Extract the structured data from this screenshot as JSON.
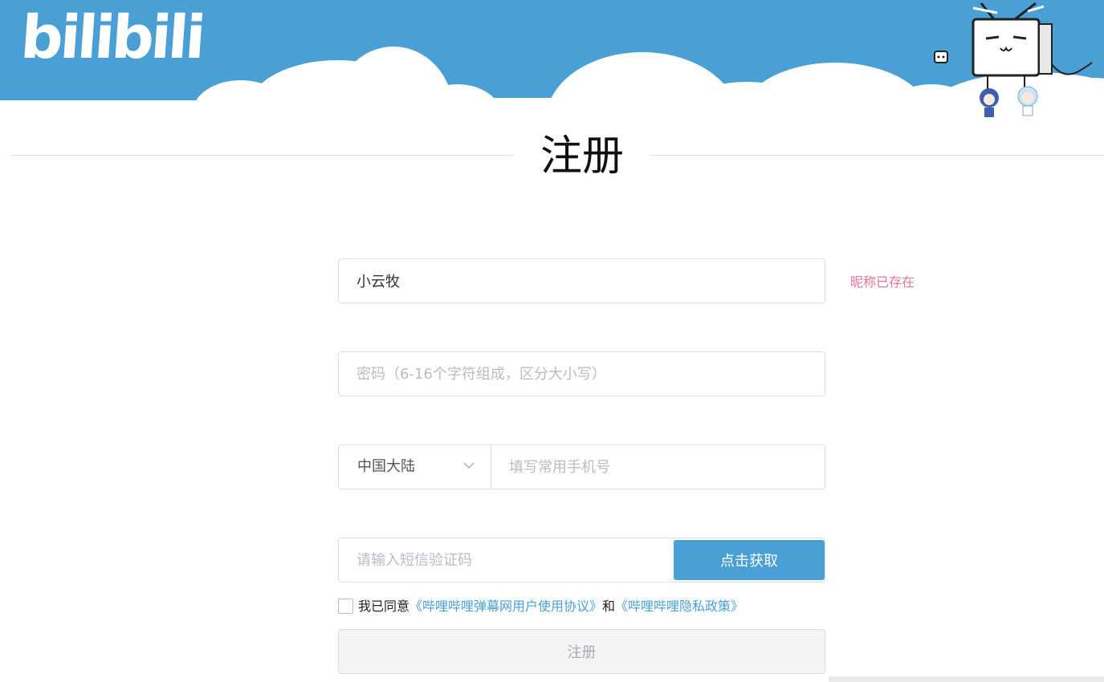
{
  "header": {
    "logo_text": "bilibili",
    "brand_color": "#4a9fd5"
  },
  "page": {
    "title": "注册"
  },
  "form": {
    "nickname": {
      "value": "小云牧",
      "placeholder": "",
      "error": "昵称已存在"
    },
    "password": {
      "value": "",
      "placeholder": "密码（6-16个字符组成，区分大小写）"
    },
    "phone": {
      "region_value": "中国大陆",
      "value": "",
      "placeholder": "填写常用手机号"
    },
    "sms_code": {
      "value": "",
      "placeholder": "请输入短信验证码",
      "button_label": "点击获取"
    },
    "agreement": {
      "prefix": "我已同意",
      "link_user_agreement": "《哔哩哔哩弹幕网用户使用协议》",
      "conjunction": "和",
      "link_privacy": "《哔哩哔哩隐私政策》",
      "checked": false
    },
    "submit_label": "注册"
  },
  "colors": {
    "error": "#e7739a",
    "link": "#4a9fd5",
    "disabled_button": "#f4f4f5"
  },
  "icons": {
    "region_dropdown": "chevron-down-icon",
    "mascot": "tv-mascot-icon"
  }
}
